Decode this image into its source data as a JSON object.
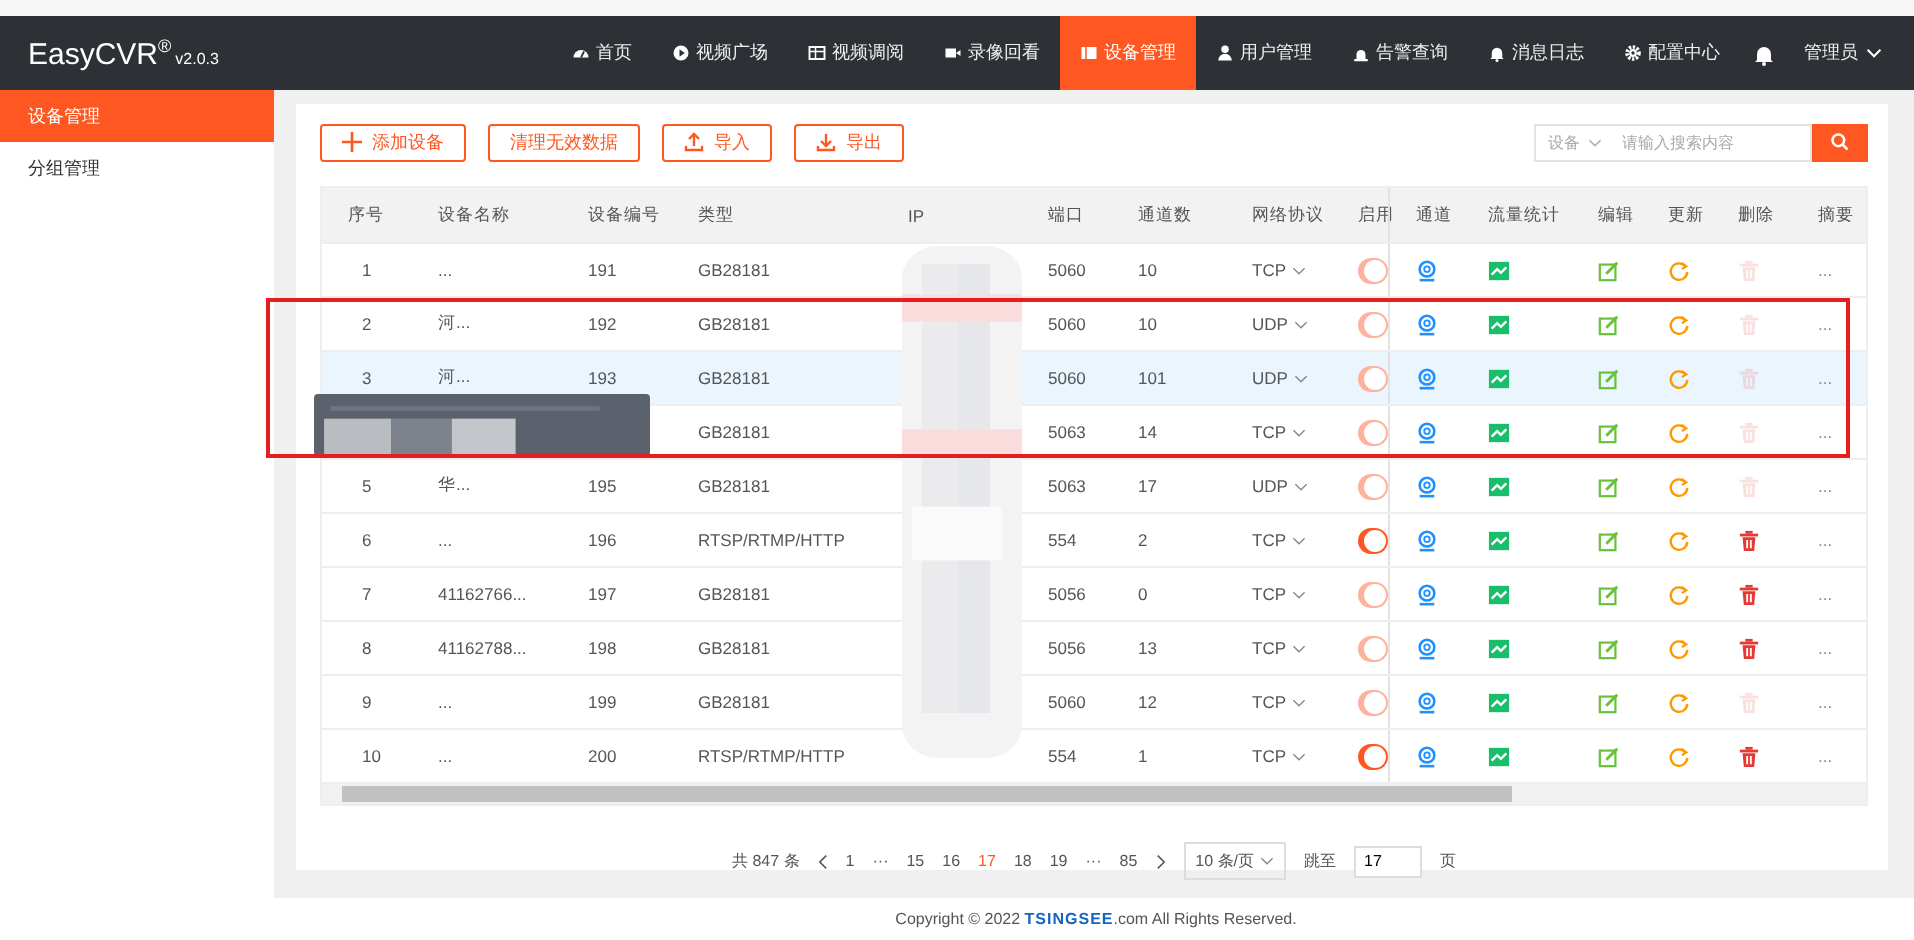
{
  "app": {
    "logo": "EasyCVR",
    "logo_mark": "®",
    "version": "v2.0.3"
  },
  "nav": [
    {
      "label": "首页",
      "selected": false
    },
    {
      "label": "视频广场",
      "selected": false
    },
    {
      "label": "视频调阅",
      "selected": false
    },
    {
      "label": "录像回看",
      "selected": false
    },
    {
      "label": "设备管理",
      "selected": true
    },
    {
      "label": "用户管理",
      "selected": false
    },
    {
      "label": "告警查询",
      "selected": false
    },
    {
      "label": "消息日志",
      "selected": false
    },
    {
      "label": "配置中心",
      "selected": false
    }
  ],
  "user": {
    "label": "管理员"
  },
  "sidebar": {
    "items": [
      {
        "label": "设备管理",
        "selected": true
      },
      {
        "label": "分组管理",
        "selected": false
      }
    ]
  },
  "toolbar": [
    {
      "label": "添加设备",
      "kind": "add"
    },
    {
      "label": "清理无效数据",
      "kind": "text"
    },
    {
      "label": "导入",
      "kind": "upload"
    },
    {
      "label": "导出",
      "kind": "download"
    }
  ],
  "search": {
    "scope": "设备",
    "placeholder": "请输入搜索内容"
  },
  "table": {
    "columns": [
      "序号",
      "设备名称",
      "设备编号",
      "类型",
      "IP",
      "端口",
      "通道数",
      "网络协议",
      "启用",
      "通道",
      "流量统计",
      "编辑",
      "更新",
      "删除",
      "摘要"
    ],
    "rows": [
      {
        "index": "1",
        "name": "...",
        "code": "191",
        "type": "GB28181",
        "port": "5060",
        "channels": "10",
        "protocol": "TCP",
        "switch_disabled": true,
        "delete_disabled": true,
        "selected": false,
        "more": "..."
      },
      {
        "index": "2",
        "name": "河...",
        "code": "192",
        "type": "GB28181",
        "port": "5060",
        "channels": "10",
        "protocol": "UDP",
        "switch_disabled": true,
        "delete_disabled": true,
        "selected": false,
        "more": "..."
      },
      {
        "index": "3",
        "name": "河...",
        "code": "193",
        "type": "GB28181",
        "port": "5060",
        "channels": "101",
        "protocol": "UDP",
        "switch_disabled": true,
        "delete_disabled": true,
        "selected": true,
        "more": "..."
      },
      {
        "type": "GB28181",
        "port": "5063",
        "channels": "14",
        "protocol": "TCP",
        "switch_disabled": true,
        "delete_disabled": true,
        "selected": false,
        "more": "..."
      },
      {
        "index": "5",
        "name": "华...",
        "code": "195",
        "type": "GB28181",
        "port": "5063",
        "channels": "17",
        "protocol": "UDP",
        "switch_disabled": true,
        "delete_disabled": true,
        "selected": false,
        "more": "..."
      },
      {
        "index": "6",
        "name": "...",
        "code": "196",
        "type": "RTSP/RTMP/HTTP",
        "port": "554",
        "channels": "2",
        "protocol": "TCP",
        "switch_disabled": false,
        "delete_disabled": false,
        "selected": false,
        "more": "..."
      },
      {
        "index": "7",
        "name": "41162766...",
        "code": "197",
        "type": "GB28181",
        "port": "5056",
        "channels": "0",
        "protocol": "TCP",
        "switch_disabled": true,
        "delete_disabled": false,
        "selected": false,
        "more": "..."
      },
      {
        "index": "8",
        "name": "41162788...",
        "code": "198",
        "type": "GB28181",
        "port": "5056",
        "channels": "13",
        "protocol": "TCP",
        "switch_disabled": true,
        "delete_disabled": false,
        "selected": false,
        "more": "..."
      },
      {
        "index": "9",
        "name": "...",
        "code": "199",
        "type": "GB28181",
        "port": "5060",
        "channels": "12",
        "protocol": "TCP",
        "switch_disabled": true,
        "delete_disabled": true,
        "selected": false,
        "more": "..."
      },
      {
        "index": "10",
        "name": "...",
        "code": "200",
        "type": "RTSP/RTMP/HTTP",
        "port": "554",
        "channels": "1",
        "protocol": "TCP",
        "switch_disabled": false,
        "delete_disabled": false,
        "selected": false,
        "more": "..."
      }
    ]
  },
  "pagination": {
    "total": "共 847 条",
    "pages": [
      {
        "label": "1",
        "selected": false
      },
      {
        "label": "···",
        "selected": false
      },
      {
        "label": "15",
        "selected": false
      },
      {
        "label": "16",
        "selected": false
      },
      {
        "label": "17",
        "selected": true
      },
      {
        "label": "18",
        "selected": false
      },
      {
        "label": "19",
        "selected": false
      },
      {
        "label": "···",
        "selected": false
      },
      {
        "label": "85",
        "selected": false
      }
    ],
    "page_size": "10 条/页",
    "jump_label": "跳至",
    "jump_value": "17",
    "jump_suffix": "页"
  },
  "footer": {
    "prefix": "Copyright © 2022 ",
    "brand": "TSINGSEE",
    "suffix": ".com All Rights Reserved."
  }
}
